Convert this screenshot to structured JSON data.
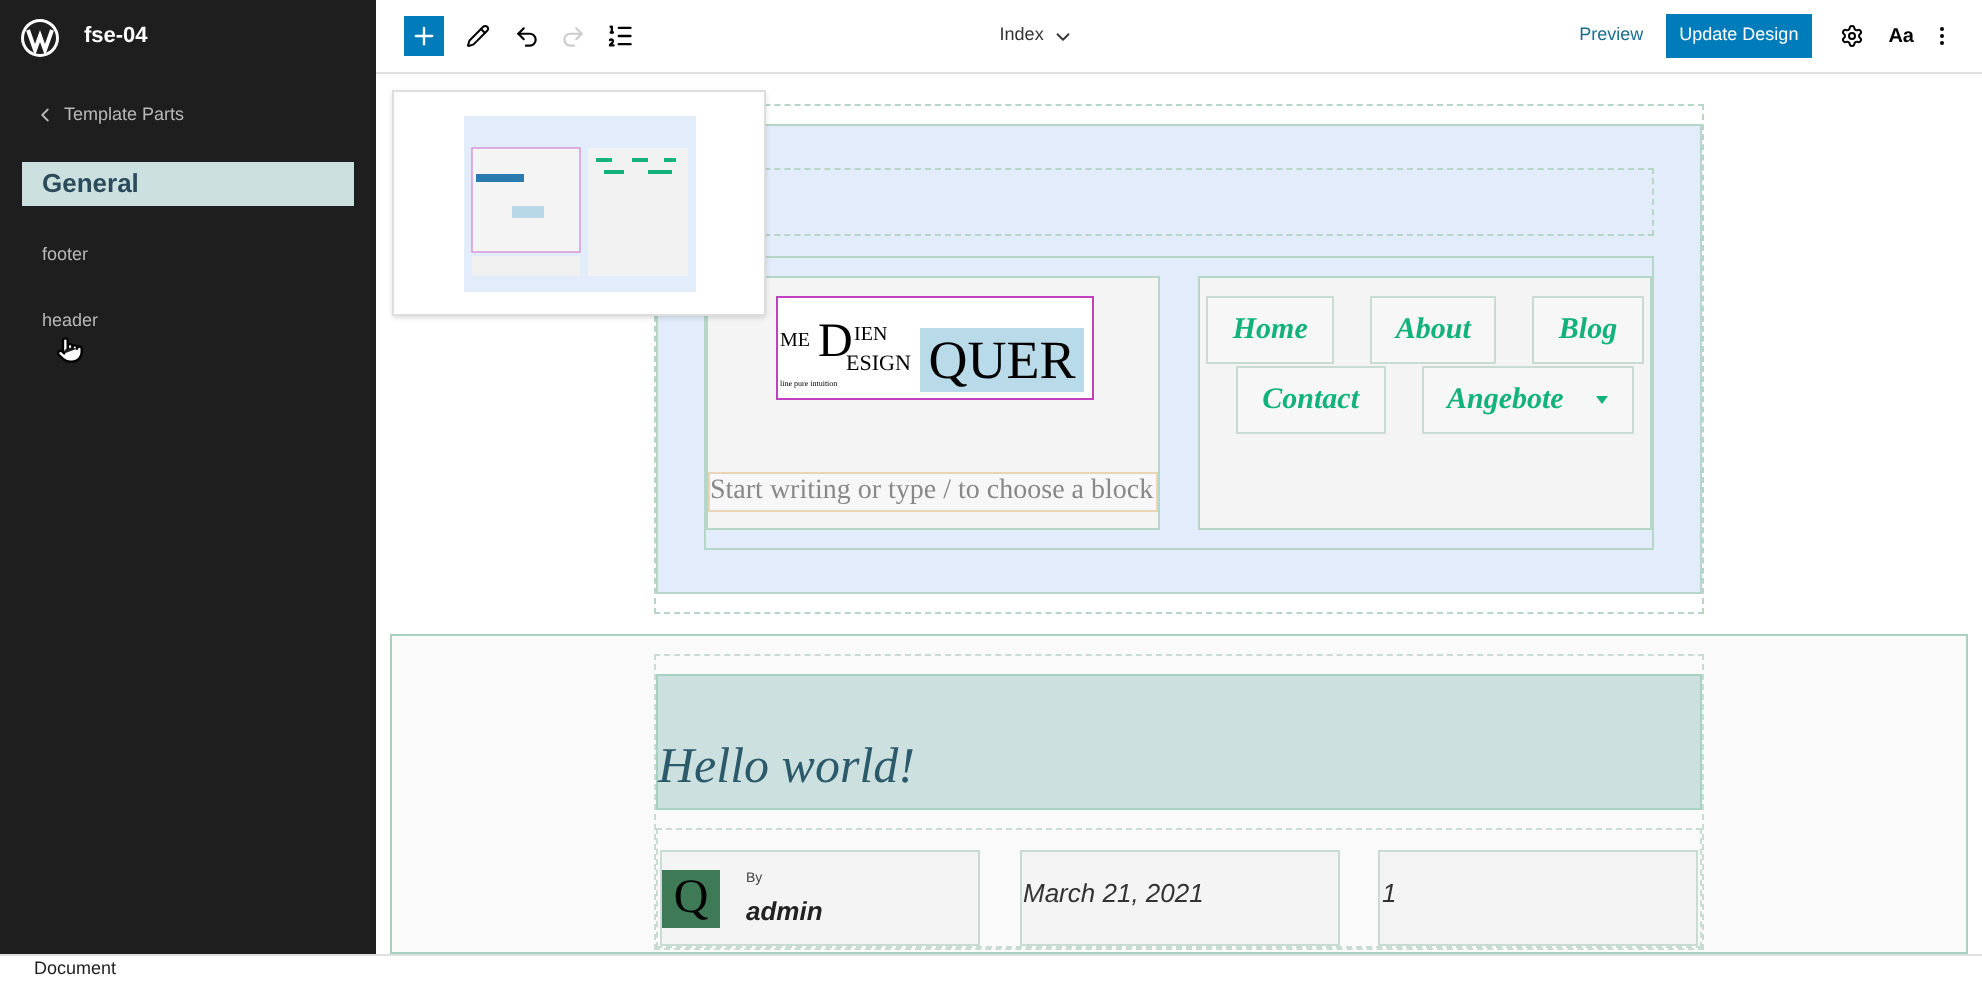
{
  "site": {
    "title": "fse-04"
  },
  "sidebar": {
    "back_label": "Template Parts",
    "items": [
      {
        "label": "General",
        "selected": true
      },
      {
        "label": "footer",
        "selected": false
      },
      {
        "label": "header",
        "selected": false
      }
    ]
  },
  "toolbar": {
    "template": "Index",
    "preview": "Preview",
    "update": "Update Design",
    "typography": "Aa"
  },
  "header_part": {
    "logo": {
      "top_left": "ME",
      "big_letter": "D",
      "top_right": "IEN",
      "bottom_right": "ESIGN",
      "tagline": "line pure intuition",
      "word": "QUER"
    },
    "placeholder": "Start writing or type / to choose a block",
    "nav": [
      {
        "label": "Home",
        "has_submenu": false
      },
      {
        "label": "About",
        "has_submenu": false
      },
      {
        "label": "Blog",
        "has_submenu": false
      },
      {
        "label": "Contact",
        "has_submenu": false
      },
      {
        "label": "Angebote",
        "has_submenu": true
      }
    ]
  },
  "post": {
    "title": "Hello world!",
    "avatar_letter": "Q",
    "author_prefix": "By",
    "author": "admin",
    "date": "March 21, 2021",
    "comments": "1"
  },
  "status_bar": "Document"
}
